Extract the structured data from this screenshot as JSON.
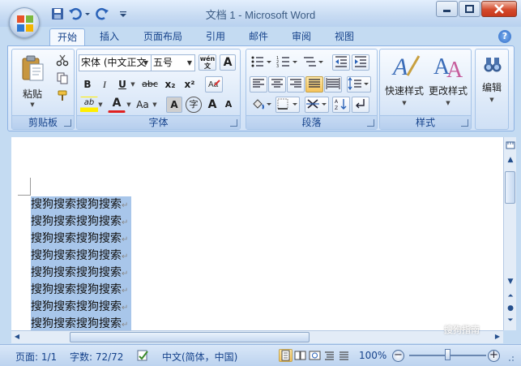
{
  "window": {
    "title": "文档 1 - Microsoft Word",
    "colors": {
      "accent": "#15428b",
      "selection": "#a8c6ea",
      "close_button": "#d44a2c"
    }
  },
  "tabs": [
    {
      "label": "开始",
      "active": true
    },
    {
      "label": "插入"
    },
    {
      "label": "页面布局"
    },
    {
      "label": "引用"
    },
    {
      "label": "邮件"
    },
    {
      "label": "审阅"
    },
    {
      "label": "视图"
    }
  ],
  "ribbon": {
    "clipboard": {
      "label": "剪贴板",
      "paste_label": "粘贴"
    },
    "font": {
      "label": "字体",
      "font_name": "宋体 (中文正文",
      "font_size": "五号",
      "phonetic": "wén\n文",
      "border_char": "A",
      "bold": "B",
      "italic": "I",
      "underline": "U",
      "strike": "abc",
      "subscript": "x₂",
      "superscript": "x²",
      "highlight_text": "ab",
      "font_color_text": "A",
      "change_case": "Aa",
      "char_shading": "A",
      "enclose": "字",
      "grow": "A",
      "shrink": "A"
    },
    "paragraph": {
      "label": "段落"
    },
    "styles": {
      "label": "样式",
      "quick_styles": "快速样式",
      "change_styles": "更改样式"
    },
    "editing": {
      "label": "编辑"
    }
  },
  "document": {
    "lines": [
      "搜狗搜索搜狗搜索",
      "搜狗搜索搜狗搜索",
      "搜狗搜索搜狗搜索",
      "搜狗搜索搜狗搜索",
      "搜狗搜索搜狗搜索",
      "搜狗搜索搜狗搜索",
      "搜狗搜索搜狗搜索",
      "搜狗搜索搜狗搜索"
    ],
    "paragraph_mark": "↵"
  },
  "statusbar": {
    "page": "页面: 1/1",
    "words": "字数: 72/72",
    "language": "中文(简体，中国)",
    "zoom": "100%",
    "zoom_level": 1.0
  },
  "watermark": "搜狗指南"
}
